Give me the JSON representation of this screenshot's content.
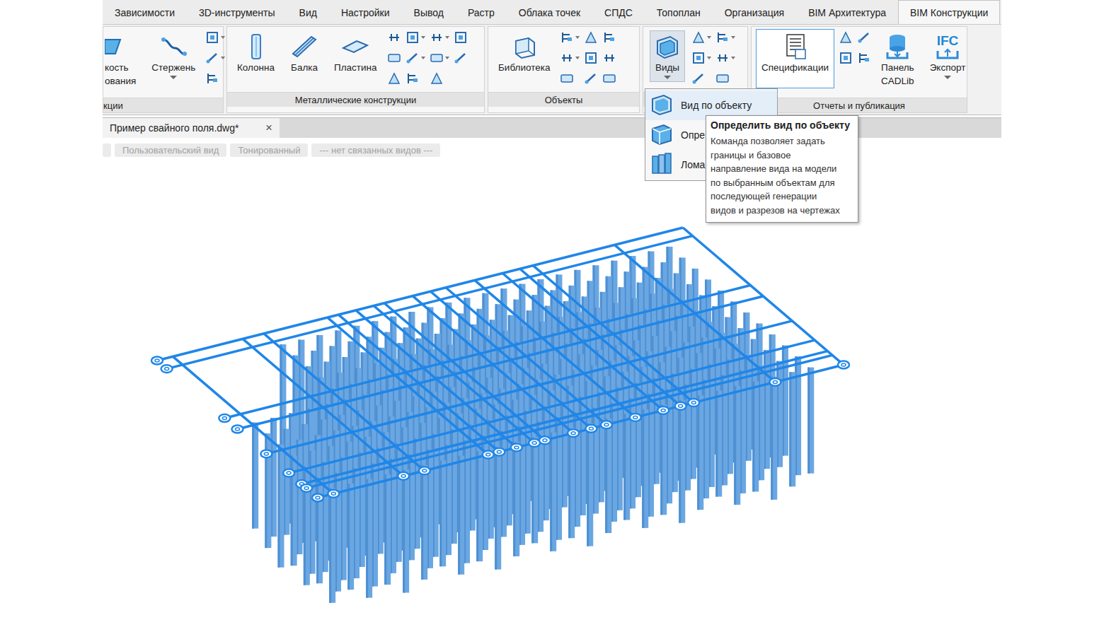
{
  "ribbon": {
    "tabs": [
      {
        "label": "Зависимости",
        "selected": false
      },
      {
        "label": "3D-инструменты",
        "selected": false
      },
      {
        "label": "Вид",
        "selected": false
      },
      {
        "label": "Настройки",
        "selected": false
      },
      {
        "label": "Вывод",
        "selected": false
      },
      {
        "label": "Растр",
        "selected": false
      },
      {
        "label": "Облака точек",
        "selected": false
      },
      {
        "label": "СПДС",
        "selected": false
      },
      {
        "label": "Топоплан",
        "selected": false
      },
      {
        "label": "Организация",
        "selected": false
      },
      {
        "label": "BIM Архитектура",
        "selected": false
      },
      {
        "label": "BIM Конструкции",
        "selected": true
      }
    ],
    "panels": [
      {
        "title": "кции",
        "buttons": [
          {
            "lines": [
              "кость",
              "ования"
            ],
            "kind": "partial",
            "dropdown": false,
            "pressed": false,
            "highlighted": false
          },
          {
            "lines": [
              "Стержень"
            ],
            "kind": "rod",
            "dropdown": true,
            "pressed": false,
            "highlighted": false
          }
        ]
      },
      {
        "title": "Металлические конструкции",
        "buttons": [
          {
            "lines": [
              "Колонна"
            ],
            "kind": "column",
            "dropdown": false,
            "pressed": false,
            "highlighted": false
          },
          {
            "lines": [
              "Балка"
            ],
            "kind": "beam",
            "dropdown": false,
            "pressed": false,
            "highlighted": false
          },
          {
            "lines": [
              "Пластина"
            ],
            "kind": "plate",
            "dropdown": false,
            "pressed": false,
            "highlighted": false
          }
        ]
      },
      {
        "title": "Объекты",
        "buttons": [
          {
            "lines": [
              "Библиотека"
            ],
            "kind": "library",
            "dropdown": false,
            "pressed": false,
            "highlighted": false
          }
        ]
      },
      {
        "buttons": [
          {
            "lines": [
              "Виды"
            ],
            "kind": "views",
            "dropdown": true,
            "pressed": true,
            "highlighted": false
          }
        ]
      },
      {
        "title": "Отчеты и публикация",
        "buttons": [
          {
            "lines": [
              "Спецификации"
            ],
            "kind": "specs",
            "dropdown": false,
            "pressed": false,
            "highlighted": true
          },
          {
            "lines": [
              "Панель",
              "CADLib"
            ],
            "kind": "cadlib",
            "dropdown": false,
            "pressed": false,
            "highlighted": false
          },
          {
            "lines": [
              "Экспорт"
            ],
            "kind": "export",
            "icon_text": "IFC",
            "dropdown": true,
            "pressed": false,
            "highlighted": false
          }
        ]
      }
    ]
  },
  "document_tab": {
    "title": "Пример свайного поля.dwg*",
    "close": "×"
  },
  "view_labels": [
    "Пользовательский вид",
    "Тонированный",
    "--- нет связанных видов ---"
  ],
  "views_menu": {
    "items": [
      {
        "label": "Вид по объекту",
        "kind": "object",
        "selected": true
      },
      {
        "label": "Опре",
        "kind": "define",
        "selected": false
      },
      {
        "label": "Лома",
        "kind": "broken",
        "selected": false
      }
    ]
  },
  "tooltip": {
    "title": "Определить вид по объекту",
    "lines": [
      "Команда позволяет задать",
      "границы и базовое",
      "направление вида на модели",
      "по выбранным объектам для",
      "последующей генерации",
      "видов и разрезов на чертежах"
    ]
  }
}
